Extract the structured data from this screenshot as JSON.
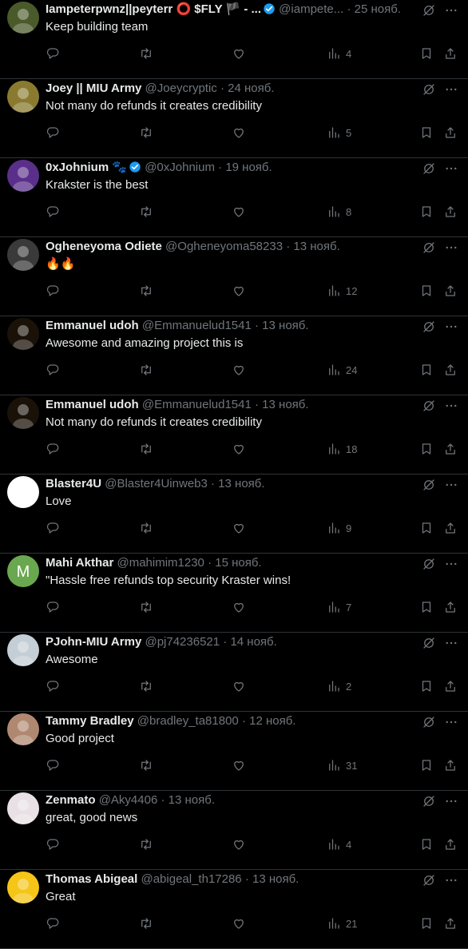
{
  "colors": {
    "background": "#000000",
    "text": "#e7e9ea",
    "muted": "#71767b",
    "verified": "#1d9bf0",
    "divider": "#2f3336"
  },
  "replies": [
    {
      "name": "Iampeterpwnz||peyterr ⭕ $FLY 🏴 - ...",
      "handle": "@iampete...",
      "date": "· 25 нояб.",
      "text": "Keep building team",
      "views": "4",
      "verified": true,
      "avatar_color": "#4a5a2a"
    },
    {
      "name": "Joey || MIU Army",
      "handle": "@Joeycryptic",
      "date": "· 24 нояб.",
      "text": "Not many do refunds it creates credibility",
      "views": "5",
      "verified": false,
      "avatar_color": "#8a7a30"
    },
    {
      "name": "0xJohnium 🐾",
      "handle": "@0xJohnium",
      "date": "· 19 нояб.",
      "text": "Krakster is the best",
      "views": "8",
      "verified": true,
      "avatar_color": "#5a2f8a"
    },
    {
      "name": "Ogheneyoma Odiete",
      "handle": "@Ogheneyoma58233",
      "date": "· 13 нояб.",
      "text": "🔥🔥",
      "views": "12",
      "verified": false,
      "avatar_color": "#3a3a3a"
    },
    {
      "name": "Emmanuel udoh",
      "handle": "@Emmanuelud1541",
      "date": "· 13 нояб.",
      "text": "Awesome and amazing project this is",
      "views": "24",
      "verified": false,
      "avatar_color": "#1a1208"
    },
    {
      "name": "Emmanuel udoh",
      "handle": "@Emmanuelud1541",
      "date": "· 13 нояб.",
      "text": "Not many do refunds it creates credibility",
      "views": "18",
      "verified": false,
      "avatar_color": "#1a1208"
    },
    {
      "name": "Blaster4U",
      "handle": "@Blaster4Uinweb3",
      "date": "· 13 нояб.",
      "text": "Love",
      "views": "9",
      "verified": false,
      "avatar_color": "#ffffff"
    },
    {
      "name": "Mahi Akthar",
      "handle": "@mahimim1230",
      "date": "· 15 нояб.",
      "text": "\"Hassle free refunds top security Kraster wins!",
      "views": "7",
      "verified": false,
      "avatar_color": "#6aa84f",
      "avatar_letter": "M"
    },
    {
      "name": "PJohn-MIU Army",
      "handle": "@pj74236521",
      "date": "· 14 нояб.",
      "text": "Awesome",
      "views": "2",
      "verified": false,
      "avatar_color": "#c3ced6"
    },
    {
      "name": "Tammy Bradley",
      "handle": "@bradley_ta81800",
      "date": "· 12 нояб.",
      "text": "Good project",
      "views": "31",
      "verified": false,
      "avatar_color": "#b08870"
    },
    {
      "name": "Zenmato",
      "handle": "@Aky4406",
      "date": "· 13 нояб.",
      "text": "great, good news",
      "views": "4",
      "verified": false,
      "avatar_color": "#e8e0e4"
    },
    {
      "name": "Thomas Abigeal",
      "handle": "@abigeal_th17286",
      "date": "· 13 нояб.",
      "text": "Great",
      "views": "21",
      "verified": false,
      "avatar_color": "#f5c518"
    }
  ],
  "icons": [
    "reply-icon",
    "retweet-icon",
    "like-icon",
    "views-icon",
    "bookmark-icon",
    "share-icon",
    "grok-icon",
    "more-icon",
    "verified-badge-icon"
  ]
}
